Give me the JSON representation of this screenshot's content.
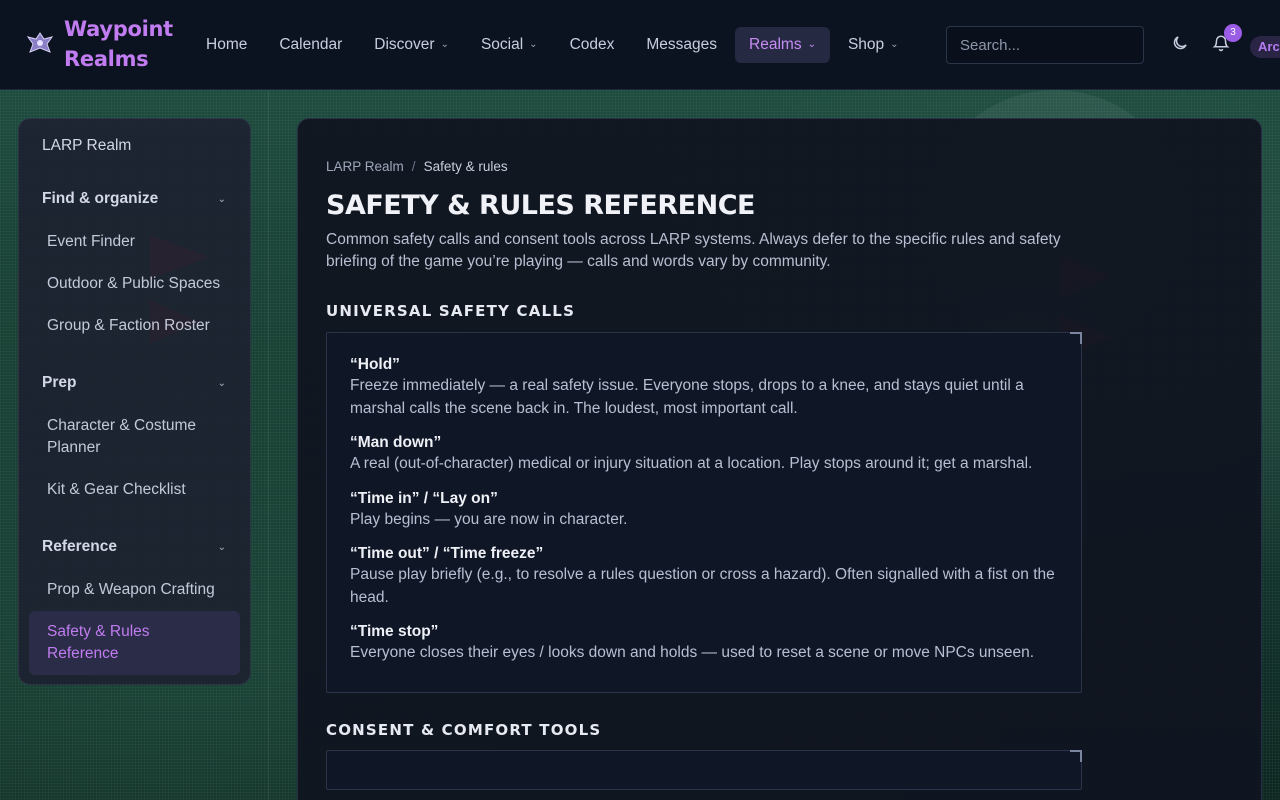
{
  "brand": {
    "name_line1": "Waypoint",
    "name_line2": "Realms",
    "accent": "#c07cf0"
  },
  "nav": {
    "items": [
      {
        "label": "Home",
        "dropdown": false,
        "active": false
      },
      {
        "label": "Calendar",
        "dropdown": false,
        "active": false
      },
      {
        "label": "Discover",
        "dropdown": true,
        "active": false
      },
      {
        "label": "Social",
        "dropdown": true,
        "active": false
      },
      {
        "label": "Codex",
        "dropdown": false,
        "active": false
      },
      {
        "label": "Messages",
        "dropdown": false,
        "active": false
      },
      {
        "label": "Realms",
        "dropdown": true,
        "active": true
      },
      {
        "label": "Shop",
        "dropdown": true,
        "active": false
      }
    ]
  },
  "search": {
    "placeholder": "Search..."
  },
  "notifications": {
    "count": "3"
  },
  "user": {
    "label": "Arc"
  },
  "sidebar": {
    "root": "LARP Realm",
    "groups": [
      {
        "title": "Find & organize",
        "items": [
          "Event Finder",
          "Outdoor & Public Spaces",
          "Group & Faction Roster"
        ]
      },
      {
        "title": "Prep",
        "items": [
          "Character & Costume Planner",
          "Kit & Gear Checklist"
        ]
      },
      {
        "title": "Reference",
        "items": [
          "Prop & Weapon Crafting",
          "Safety & Rules Reference"
        ]
      }
    ],
    "active": "Safety & Rules Reference"
  },
  "breadcrumb": {
    "root": "LARP Realm",
    "separator": "/",
    "current": "Safety & rules"
  },
  "page": {
    "title": "Safety & Rules Reference",
    "intro": "Common safety calls and consent tools across LARP systems. Always defer to the specific rules and safety briefing of the game you’re playing — calls and words vary by community."
  },
  "sections": {
    "universal": {
      "heading": "Universal safety calls",
      "calls": [
        {
          "name": "“Hold”",
          "desc": "Freeze immediately — a real safety issue. Everyone stops, drops to a knee, and stays quiet until a marshal calls the scene back in. The loudest, most important call."
        },
        {
          "name": "“Man down”",
          "desc": "A real (out-of-character) medical or injury situation at a location. Play stops around it; get a marshal."
        },
        {
          "name": "“Time in” / “Lay on”",
          "desc": "Play begins — you are now in character."
        },
        {
          "name": "“Time out” / “Time freeze”",
          "desc": "Pause play briefly (e.g., to resolve a rules question or cross a hazard). Often signalled with a fist on the head."
        },
        {
          "name": "“Time stop”",
          "desc": "Everyone closes their eyes / looks down and holds — used to reset a scene or move NPCs unseen."
        }
      ]
    },
    "consent": {
      "heading": "Consent & comfort tools"
    }
  }
}
